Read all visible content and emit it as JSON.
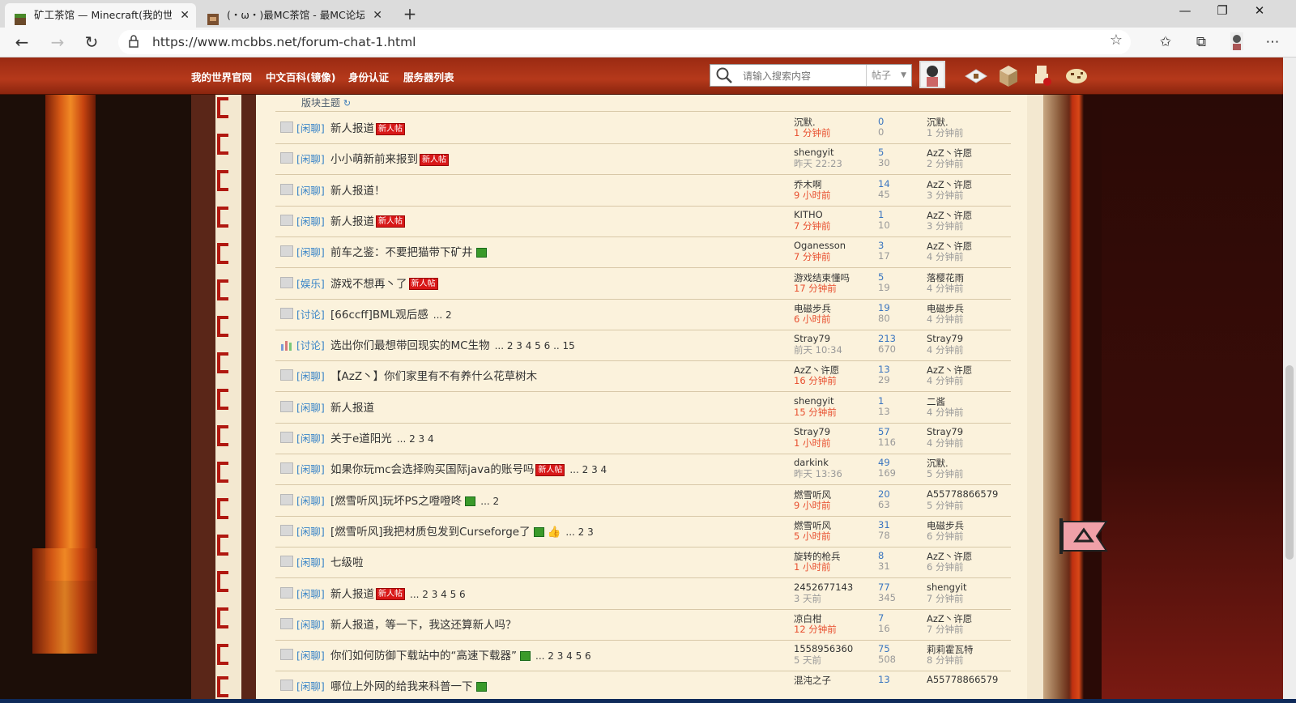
{
  "browser": {
    "tabs": [
      {
        "title": "矿工茶馆 — Minecraft(我的世界)",
        "active": true
      },
      {
        "title": "(・ω・)最MC茶馆 - 最MC论坛",
        "active": false
      }
    ],
    "url": "https://www.mcbbs.net/forum-chat-1.html"
  },
  "forum_nav": {
    "links": [
      "我的世界官网",
      "中文百科(镜像)",
      "身份认证",
      "服务器列表"
    ],
    "search_placeholder": "请输入搜索内容",
    "search_type": "帖子"
  },
  "thread_list": {
    "header": "版块主题",
    "new_badge": "新人帖",
    "rows": [
      {
        "cat": "[闲聊]",
        "title": "新人报道",
        "new": true,
        "img": false,
        "pages": "",
        "author": "沉默.",
        "adate": "1 分钟前",
        "anew": true,
        "replies": "0",
        "views": "0",
        "last": "沉默.",
        "ldate": "1 分钟前"
      },
      {
        "cat": "[闲聊]",
        "title": "小小萌新前来报到",
        "new": true,
        "img": false,
        "pages": "",
        "author": "shengyit",
        "adate": "昨天 22:23",
        "anew": false,
        "replies": "5",
        "views": "30",
        "last": "AzZ丶许愿",
        "ldate": "2 分钟前"
      },
      {
        "cat": "[闲聊]",
        "title": "新人报道！",
        "new": false,
        "img": false,
        "pages": "",
        "author": "乔木啊",
        "adate": "9 小时前",
        "anew": true,
        "replies": "14",
        "views": "45",
        "last": "AzZ丶许愿",
        "ldate": "3 分钟前"
      },
      {
        "cat": "[闲聊]",
        "title": "新人报道",
        "new": true,
        "img": false,
        "pages": "",
        "author": "KITHO",
        "adate": "7 分钟前",
        "anew": true,
        "replies": "1",
        "views": "10",
        "last": "AzZ丶许愿",
        "ldate": "3 分钟前"
      },
      {
        "cat": "[闲聊]",
        "title": "前车之鉴：不要把猫带下矿井",
        "new": false,
        "img": true,
        "pages": "",
        "author": "Oganesson",
        "adate": "7 分钟前",
        "anew": true,
        "replies": "3",
        "views": "17",
        "last": "AzZ丶许愿",
        "ldate": "4 分钟前"
      },
      {
        "cat": "[娱乐]",
        "title": "游戏不想再丶了",
        "new": true,
        "img": false,
        "pages": "",
        "author": "游戏结束懂吗",
        "adate": "17 分钟前",
        "anew": true,
        "replies": "5",
        "views": "19",
        "last": "落樱花雨",
        "ldate": "4 分钟前"
      },
      {
        "cat": "[讨论]",
        "title": "[66ccff]BML观后感",
        "new": false,
        "img": false,
        "pages": "... 2",
        "author": "电磁步兵",
        "adate": "6 小时前",
        "anew": true,
        "replies": "19",
        "views": "80",
        "last": "电磁步兵",
        "ldate": "4 分钟前"
      },
      {
        "cat": "[讨论]",
        "title": "选出你们最想带回现实的MC生物",
        "new": false,
        "img": false,
        "pages": "... 2 3 4 5 6 .. 15",
        "author": "Stray79",
        "adate": "前天 10:34",
        "anew": false,
        "replies": "213",
        "views": "670",
        "last": "Stray79",
        "ldate": "4 分钟前",
        "poll": true
      },
      {
        "cat": "[闲聊]",
        "title": "【AzZ丶】你们家里有不有养什么花草树木",
        "new": false,
        "img": false,
        "pages": "",
        "author": "AzZ丶许愿",
        "adate": "16 分钟前",
        "anew": true,
        "replies": "13",
        "views": "29",
        "last": "AzZ丶许愿",
        "ldate": "4 分钟前"
      },
      {
        "cat": "[闲聊]",
        "title": "新人报道",
        "new": false,
        "img": false,
        "pages": "",
        "author": "shengyit",
        "adate": "15 分钟前",
        "anew": true,
        "replies": "1",
        "views": "13",
        "last": "二酱",
        "ldate": "4 分钟前"
      },
      {
        "cat": "[闲聊]",
        "title": "关于e道阳光",
        "new": false,
        "img": false,
        "pages": "... 2 3 4",
        "author": "Stray79",
        "adate": "1 小时前",
        "anew": true,
        "replies": "57",
        "views": "116",
        "last": "Stray79",
        "ldate": "4 分钟前"
      },
      {
        "cat": "[闲聊]",
        "title": "如果你玩mc会选择购买国际java的账号吗",
        "new": true,
        "img": false,
        "pages": "... 2 3 4",
        "author": "darkink",
        "adate": "昨天 13:36",
        "anew": false,
        "replies": "49",
        "views": "169",
        "last": "沉默.",
        "ldate": "5 分钟前"
      },
      {
        "cat": "[闲聊]",
        "title": "[燃雪听风]玩坏PS之噔噔咚",
        "new": false,
        "img": true,
        "pages": "... 2",
        "author": "燃雪听风",
        "adate": "9 小时前",
        "anew": true,
        "replies": "20",
        "views": "63",
        "last": "A55778866579",
        "ldate": "5 分钟前"
      },
      {
        "cat": "[闲聊]",
        "title": "[燃雪听风]我把材质包发到Curseforge了",
        "new": false,
        "img": true,
        "pages": "... 2 3",
        "author": "燃雪听风",
        "adate": "5 小时前",
        "anew": true,
        "replies": "31",
        "views": "78",
        "last": "电磁步兵",
        "ldate": "6 分钟前",
        "thumb": true
      },
      {
        "cat": "[闲聊]",
        "title": "七级啦",
        "new": false,
        "img": false,
        "pages": "",
        "author": "旋转的枪兵",
        "adate": "1 小时前",
        "anew": true,
        "replies": "8",
        "views": "31",
        "last": "AzZ丶许愿",
        "ldate": "6 分钟前"
      },
      {
        "cat": "[闲聊]",
        "title": "新人报道",
        "new": true,
        "img": false,
        "pages": "... 2 3 4 5 6",
        "author": "2452677143",
        "adate": "3 天前",
        "anew": false,
        "replies": "77",
        "views": "345",
        "last": "shengyit",
        "ldate": "7 分钟前"
      },
      {
        "cat": "[闲聊]",
        "title": "新人报道，等一下，我这还算新人吗？",
        "new": false,
        "img": false,
        "pages": "",
        "author": "凉白柑",
        "adate": "12 分钟前",
        "anew": true,
        "replies": "7",
        "views": "16",
        "last": "AzZ丶许愿",
        "ldate": "7 分钟前"
      },
      {
        "cat": "[闲聊]",
        "title": "你们如何防御下载站中的“高速下载器”",
        "new": false,
        "img": true,
        "pages": "... 2 3 4 5 6",
        "author": "1558956360",
        "adate": "5 天前",
        "anew": false,
        "replies": "75",
        "views": "508",
        "last": "莉莉霍瓦特",
        "ldate": "8 分钟前"
      },
      {
        "cat": "[闲聊]",
        "title": "哪位上外网的给我来科普一下",
        "new": false,
        "img": true,
        "pages": "",
        "author": "混沌之子",
        "adate": "",
        "anew": false,
        "replies": "13",
        "views": "",
        "last": "A55778866579",
        "ldate": ""
      }
    ]
  }
}
